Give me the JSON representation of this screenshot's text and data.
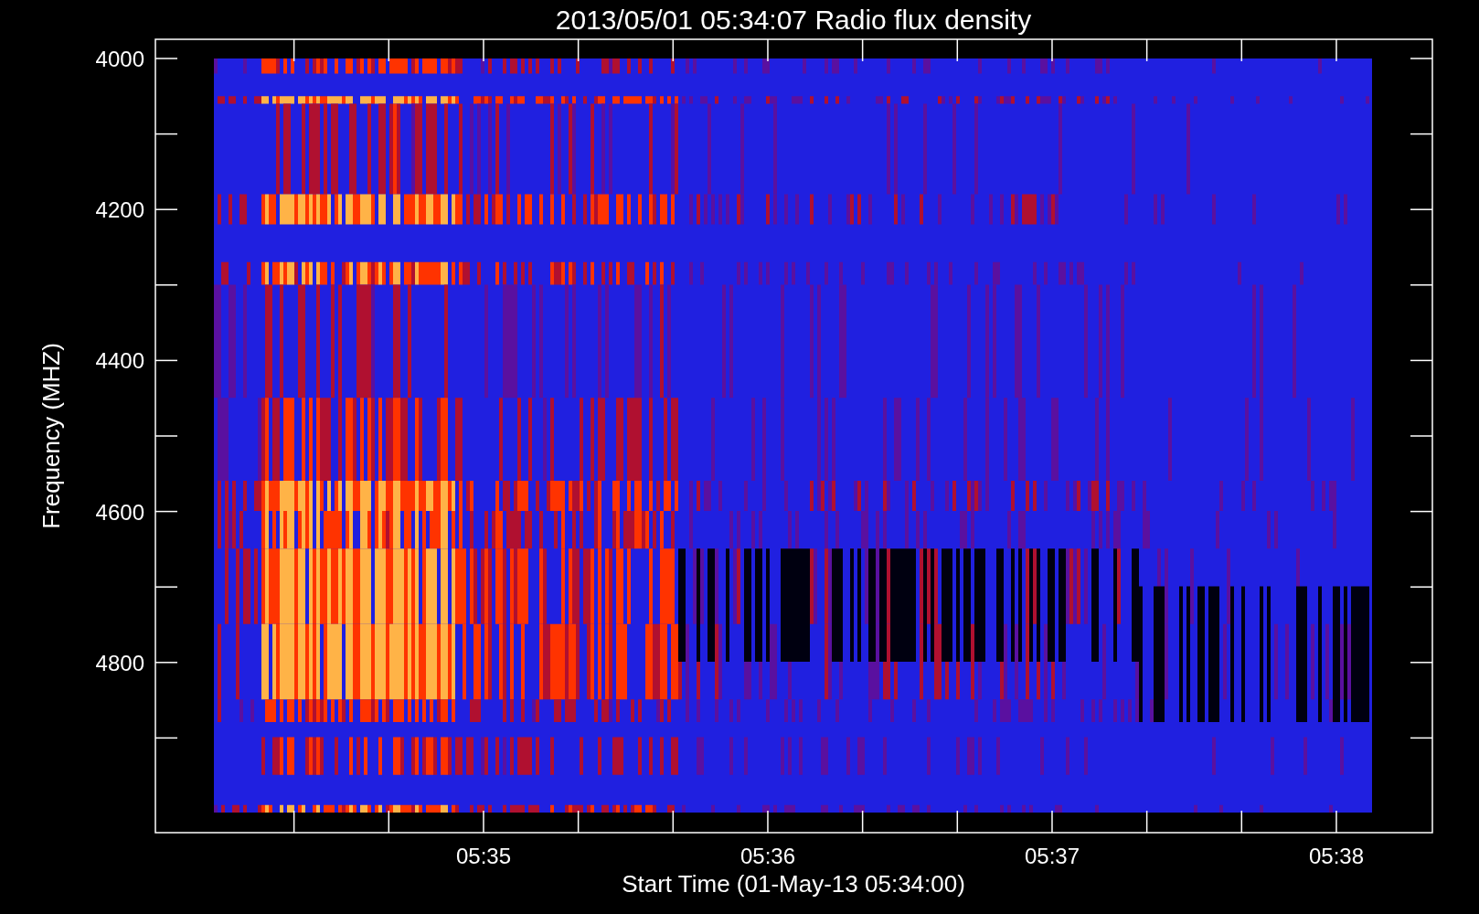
{
  "title": "2013/05/01 05:34:07 Radio flux density",
  "y_axis": {
    "label": "Frequency (MHZ)",
    "tick_labels": [
      "4000",
      "4200",
      "4400",
      "4600",
      "4800"
    ]
  },
  "x_axis": {
    "label": "Start Time (01-May-13 05:34:00)",
    "tick_labels": [
      "05:35",
      "05:36",
      "05:37",
      "05:38"
    ]
  }
}
